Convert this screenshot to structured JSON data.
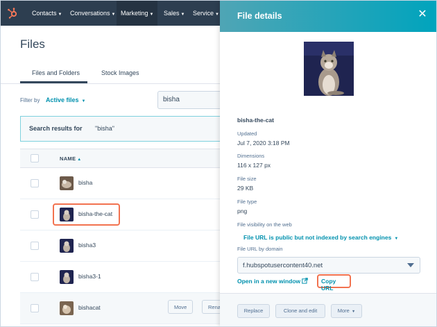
{
  "nav": {
    "items": [
      {
        "label": "Contacts"
      },
      {
        "label": "Conversations"
      },
      {
        "label": "Marketing"
      },
      {
        "label": "Sales"
      },
      {
        "label": "Service"
      }
    ]
  },
  "files_page": {
    "title": "Files",
    "tabs": [
      {
        "label": "Files and Folders"
      },
      {
        "label": "Stock Images"
      }
    ],
    "filter_label": "Filter by",
    "filter_value": "Active files",
    "search_value": "bisha",
    "results_label": "Search results for",
    "results_query": "\"bisha\"",
    "table": {
      "column_name": "NAME",
      "rows": [
        {
          "name": "bisha"
        },
        {
          "name": "bisha-the-cat"
        },
        {
          "name": "bisha3"
        },
        {
          "name": "bisha3-1"
        },
        {
          "name": "bishacat"
        }
      ],
      "row_actions": {
        "move": "Move",
        "rename": "Rena"
      }
    }
  },
  "panel": {
    "title": "File details",
    "filename": "bisha-the-cat",
    "updated_label": "Updated",
    "updated_value": "Jul 7, 2020 3:18 PM",
    "dimensions_label": "Dimensions",
    "dimensions_value": "116 x 127 px",
    "size_label": "File size",
    "size_value": "29 KB",
    "type_label": "File type",
    "type_value": "png",
    "visibility_label": "File visibility on the web",
    "visibility_value": "File URL is public but not indexed by search engines",
    "domain_label": "File URL by domain",
    "domain_value": "f.hubspotusercontent40.net",
    "open_link": "Open in a new window",
    "copy_url": "Copy URL",
    "footer": {
      "replace": "Replace",
      "clone": "Clone and edit",
      "more": "More"
    }
  },
  "colors": {
    "nav_bg": "#2d3e50",
    "accent": "#0091ae",
    "highlight": "#f2724f",
    "panel_header": "#00a4bd"
  }
}
